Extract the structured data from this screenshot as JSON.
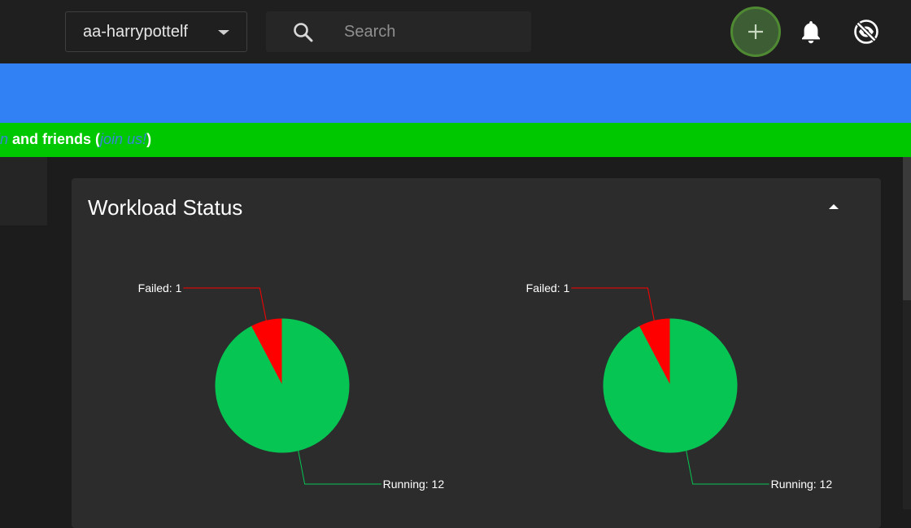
{
  "header": {
    "namespace": "aa-harrypottelf",
    "search_placeholder": "Search"
  },
  "banner": {
    "prefix_link": "uin",
    "text_before_link": " and friends (",
    "link_text": "join us!",
    "text_after_link": ")"
  },
  "panel": {
    "title": "Workload Status"
  },
  "chart_data": [
    {
      "type": "pie",
      "labels": [
        "Failed: 1",
        "Running: 12"
      ],
      "slices": [
        {
          "name": "Failed",
          "value": 1,
          "color": "#ff0000"
        },
        {
          "name": "Running",
          "value": 12,
          "color": "#07c553"
        }
      ]
    },
    {
      "type": "pie",
      "labels": [
        "Failed: 1",
        "Running: 12"
      ],
      "slices": [
        {
          "name": "Failed",
          "value": 1,
          "color": "#ff0000"
        },
        {
          "name": "Running",
          "value": 12,
          "color": "#07c553"
        }
      ]
    }
  ],
  "colors": {
    "topbar": "#1f1f1f",
    "blue_banner": "#3181f4",
    "green_banner": "#00c800",
    "add_button": "#3d5e35",
    "failed": "#ff0000",
    "running": "#07c553"
  },
  "icons": [
    "search-icon",
    "plus-icon",
    "bell-icon",
    "eye-off-icon",
    "chevron-down-icon",
    "chevron-up-icon"
  ]
}
